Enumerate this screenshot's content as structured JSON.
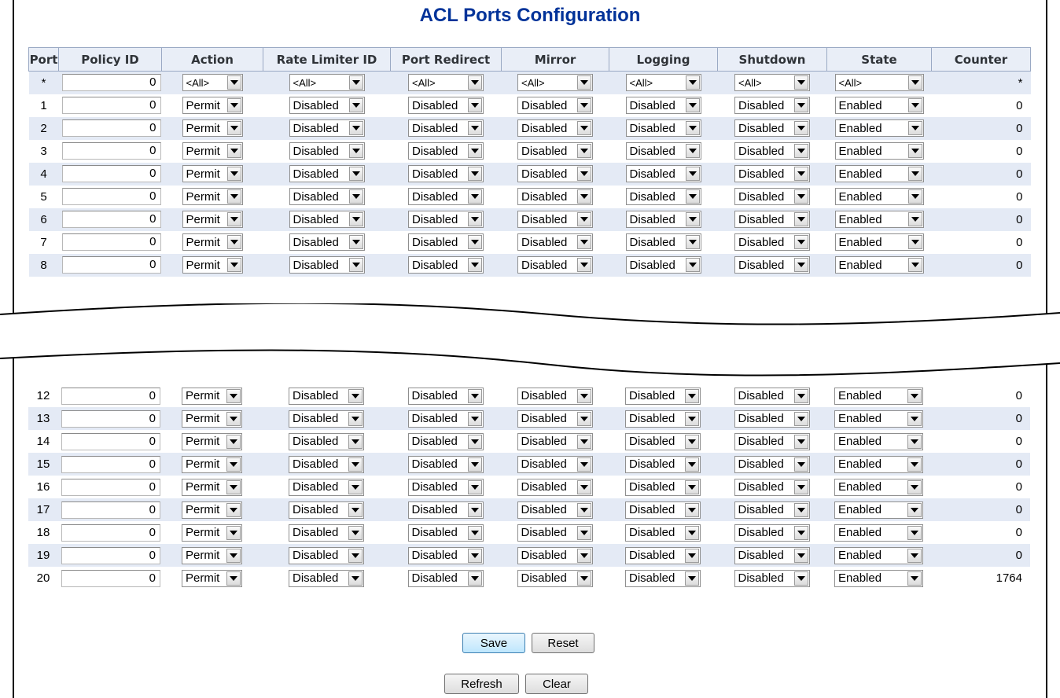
{
  "title": "ACL Ports Configuration",
  "columns": [
    "Port",
    "Policy ID",
    "Action",
    "Rate Limiter ID",
    "Port Redirect",
    "Mirror",
    "Logging",
    "Shutdown",
    "State",
    "Counter"
  ],
  "all_row": {
    "port": "*",
    "policy_id": "0",
    "action": "<All>",
    "rate_limiter": "<All>",
    "port_redirect": "<All>",
    "mirror": "<All>",
    "logging": "<All>",
    "shutdown": "<All>",
    "state": "<All>",
    "counter": "*"
  },
  "rows_top": [
    {
      "port": "1",
      "policy_id": "0",
      "action": "Permit",
      "rate_limiter": "Disabled",
      "port_redirect": "Disabled",
      "mirror": "Disabled",
      "logging": "Disabled",
      "shutdown": "Disabled",
      "state": "Enabled",
      "counter": "0"
    },
    {
      "port": "2",
      "policy_id": "0",
      "action": "Permit",
      "rate_limiter": "Disabled",
      "port_redirect": "Disabled",
      "mirror": "Disabled",
      "logging": "Disabled",
      "shutdown": "Disabled",
      "state": "Enabled",
      "counter": "0"
    },
    {
      "port": "3",
      "policy_id": "0",
      "action": "Permit",
      "rate_limiter": "Disabled",
      "port_redirect": "Disabled",
      "mirror": "Disabled",
      "logging": "Disabled",
      "shutdown": "Disabled",
      "state": "Enabled",
      "counter": "0"
    },
    {
      "port": "4",
      "policy_id": "0",
      "action": "Permit",
      "rate_limiter": "Disabled",
      "port_redirect": "Disabled",
      "mirror": "Disabled",
      "logging": "Disabled",
      "shutdown": "Disabled",
      "state": "Enabled",
      "counter": "0"
    },
    {
      "port": "5",
      "policy_id": "0",
      "action": "Permit",
      "rate_limiter": "Disabled",
      "port_redirect": "Disabled",
      "mirror": "Disabled",
      "logging": "Disabled",
      "shutdown": "Disabled",
      "state": "Enabled",
      "counter": "0"
    },
    {
      "port": "6",
      "policy_id": "0",
      "action": "Permit",
      "rate_limiter": "Disabled",
      "port_redirect": "Disabled",
      "mirror": "Disabled",
      "logging": "Disabled",
      "shutdown": "Disabled",
      "state": "Enabled",
      "counter": "0"
    },
    {
      "port": "7",
      "policy_id": "0",
      "action": "Permit",
      "rate_limiter": "Disabled",
      "port_redirect": "Disabled",
      "mirror": "Disabled",
      "logging": "Disabled",
      "shutdown": "Disabled",
      "state": "Enabled",
      "counter": "0"
    },
    {
      "port": "8",
      "policy_id": "0",
      "action": "Permit",
      "rate_limiter": "Disabled",
      "port_redirect": "Disabled",
      "mirror": "Disabled",
      "logging": "Disabled",
      "shutdown": "Disabled",
      "state": "Enabled",
      "counter": "0"
    }
  ],
  "rows_bottom": [
    {
      "port": "12",
      "policy_id": "0",
      "action": "Permit",
      "rate_limiter": "Disabled",
      "port_redirect": "Disabled",
      "mirror": "Disabled",
      "logging": "Disabled",
      "shutdown": "Disabled",
      "state": "Enabled",
      "counter": "0"
    },
    {
      "port": "13",
      "policy_id": "0",
      "action": "Permit",
      "rate_limiter": "Disabled",
      "port_redirect": "Disabled",
      "mirror": "Disabled",
      "logging": "Disabled",
      "shutdown": "Disabled",
      "state": "Enabled",
      "counter": "0"
    },
    {
      "port": "14",
      "policy_id": "0",
      "action": "Permit",
      "rate_limiter": "Disabled",
      "port_redirect": "Disabled",
      "mirror": "Disabled",
      "logging": "Disabled",
      "shutdown": "Disabled",
      "state": "Enabled",
      "counter": "0"
    },
    {
      "port": "15",
      "policy_id": "0",
      "action": "Permit",
      "rate_limiter": "Disabled",
      "port_redirect": "Disabled",
      "mirror": "Disabled",
      "logging": "Disabled",
      "shutdown": "Disabled",
      "state": "Enabled",
      "counter": "0"
    },
    {
      "port": "16",
      "policy_id": "0",
      "action": "Permit",
      "rate_limiter": "Disabled",
      "port_redirect": "Disabled",
      "mirror": "Disabled",
      "logging": "Disabled",
      "shutdown": "Disabled",
      "state": "Enabled",
      "counter": "0"
    },
    {
      "port": "17",
      "policy_id": "0",
      "action": "Permit",
      "rate_limiter": "Disabled",
      "port_redirect": "Disabled",
      "mirror": "Disabled",
      "logging": "Disabled",
      "shutdown": "Disabled",
      "state": "Enabled",
      "counter": "0"
    },
    {
      "port": "18",
      "policy_id": "0",
      "action": "Permit",
      "rate_limiter": "Disabled",
      "port_redirect": "Disabled",
      "mirror": "Disabled",
      "logging": "Disabled",
      "shutdown": "Disabled",
      "state": "Enabled",
      "counter": "0"
    },
    {
      "port": "19",
      "policy_id": "0",
      "action": "Permit",
      "rate_limiter": "Disabled",
      "port_redirect": "Disabled",
      "mirror": "Disabled",
      "logging": "Disabled",
      "shutdown": "Disabled",
      "state": "Enabled",
      "counter": "0"
    },
    {
      "port": "20",
      "policy_id": "0",
      "action": "Permit",
      "rate_limiter": "Disabled",
      "port_redirect": "Disabled",
      "mirror": "Disabled",
      "logging": "Disabled",
      "shutdown": "Disabled",
      "state": "Enabled",
      "counter": "1764"
    }
  ],
  "buttons": {
    "save": "Save",
    "reset": "Reset",
    "refresh": "Refresh",
    "clear": "Clear"
  },
  "colors": {
    "title": "#003399",
    "row_alt": "#e4eaf5",
    "header_bg": "#e9eef7"
  }
}
